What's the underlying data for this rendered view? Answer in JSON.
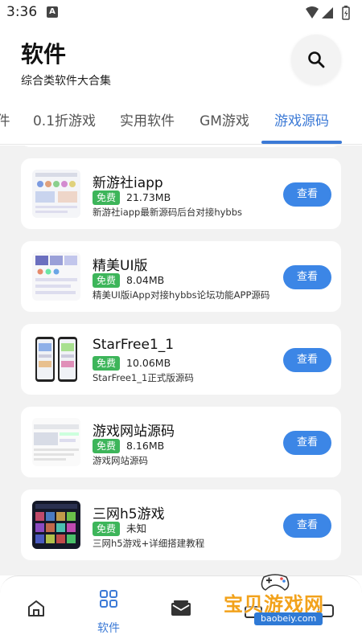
{
  "status_bar": {
    "time": "3:36",
    "notification_letter": "A"
  },
  "header": {
    "title": "软件",
    "subtitle": "综合类软件大合集"
  },
  "tabs": [
    {
      "label": "件"
    },
    {
      "label": "0.1折游戏"
    },
    {
      "label": "实用软件"
    },
    {
      "label": "GM游戏"
    },
    {
      "label": "游戏源码",
      "active": true
    }
  ],
  "items": [
    {
      "title": "新游社iapp",
      "badge": "免费",
      "size": "21.73MB",
      "desc": "新游社iapp最新源码后台对接hybbs",
      "button": "查看"
    },
    {
      "title": "精美UI版",
      "badge": "免费",
      "size": "8.04MB",
      "desc": "精美UI版iApp对接hybbs论坛功能APP源码",
      "button": "查看"
    },
    {
      "title": "StarFree1_1",
      "badge": "免费",
      "size": "10.06MB",
      "desc": "StarFree1_1正式版源码",
      "button": "查看"
    },
    {
      "title": "游戏网站源码",
      "badge": "免费",
      "size": "8.16MB",
      "desc": "游戏网站源码",
      "button": "查看"
    },
    {
      "title": "三网h5游戏",
      "badge": "免费",
      "size": "未知",
      "desc": "三网h5游戏+详细搭建教程",
      "button": "查看"
    }
  ],
  "bottom_nav": {
    "active_label": "软件"
  },
  "watermark": {
    "text": "宝贝游戏网",
    "url": "baobeiy.com"
  },
  "colors": {
    "accent": "#3c7ad6",
    "button": "#3c86e6",
    "free_badge": "#3db55a",
    "background": "#f2f2f2"
  }
}
